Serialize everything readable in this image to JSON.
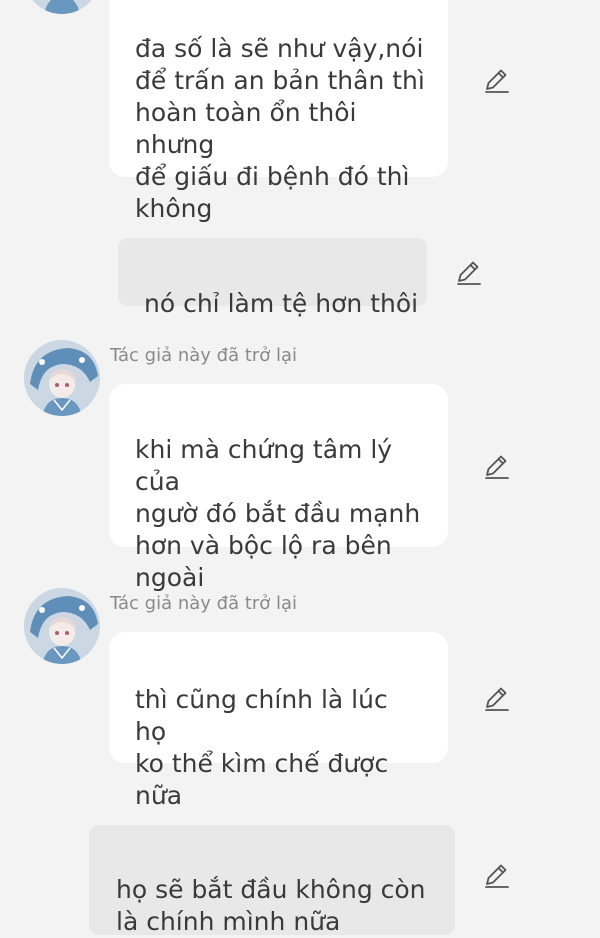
{
  "messages": [
    {
      "type": "incoming-continued",
      "text": "đa số là sẽ như vậy,nói\nđể trấn an bản thân thì\nhoàn toàn ổn thôi nhưng\nđể giấu đi bệnh đó thì\nkhông",
      "edit_icon": "pencil-edit-icon"
    },
    {
      "type": "outgoing",
      "text": "nó chỉ làm tệ hơn thôi",
      "edit_icon": "pencil-edit-icon"
    },
    {
      "type": "incoming",
      "author": "Tác giả này đã trở lại",
      "avatar": "anime-shark-hoodie-avatar",
      "text": "khi mà chứng tâm lý của\nngườ đó bắt đầu mạnh\nhơn và bộc lộ ra bên\nngoài",
      "edit_icon": "pencil-edit-icon"
    },
    {
      "type": "incoming",
      "author": "Tác giả này đã trở lại",
      "avatar": "anime-shark-hoodie-avatar",
      "text": "thì cũng chính là lúc họ\nko thể kìm chế được\nnữa",
      "edit_icon": "pencil-edit-icon"
    },
    {
      "type": "outgoing",
      "text": "họ sẽ bắt đầu không còn\nlà chính mình nữa",
      "edit_icon": "pencil-edit-icon"
    }
  ],
  "colors": {
    "background": "#f3f3f3",
    "incoming_bubble": "#ffffff",
    "outgoing_bubble": "#e8e8e8",
    "text": "#3a3a3a",
    "author_text": "#8a8a8a",
    "icon": "#555555"
  }
}
